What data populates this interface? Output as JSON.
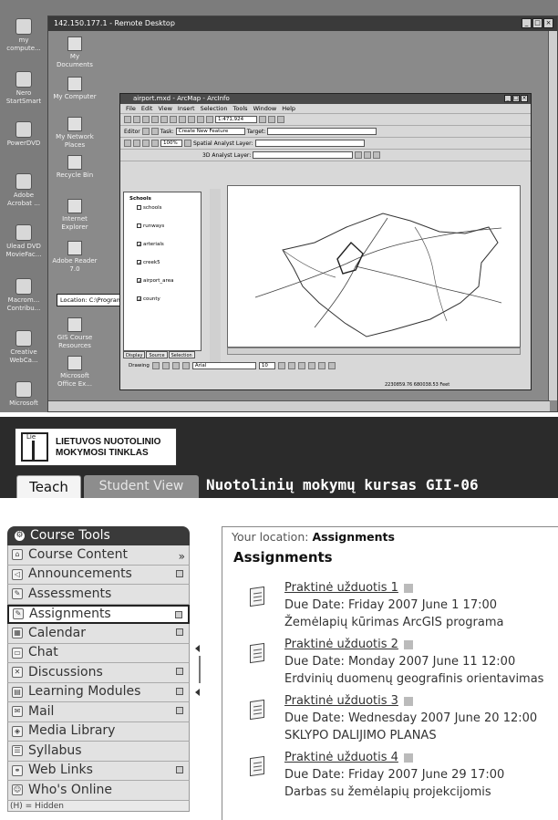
{
  "remote_desktop": {
    "title": "142.150.177.1 - Remote Desktop",
    "outer_icons": [
      "my\ncompute...",
      "Nero\nStartSmart",
      "PowerDVD",
      "Adobe\nAcrobat ...",
      "Ulead DVD\nMovieFac...",
      "Macrom...\nContribu...",
      "Creative\nWebCa...",
      "Microsoft"
    ],
    "inner_icons": [
      "My Documents",
      "My Computer",
      "My Network\nPlaces",
      "Recycle Bin",
      "Internet\nExplorer",
      "Adobe Reader\n7.0",
      "GIS Course\nResources",
      "Microsoft\nOffice Ex..."
    ],
    "tooltip": "Location: C:\\Program Files\\ArcGIS\\bin"
  },
  "arcmap": {
    "title": "airport.mxd - ArcMap - ArcInfo",
    "menu": [
      "File",
      "Edit",
      "View",
      "Insert",
      "Selection",
      "Tools",
      "Window",
      "Help"
    ],
    "scale": "1:471,924",
    "editor_label": "Editor",
    "task_label": "Task:",
    "task_value": "Create New Feature",
    "target_label": "Target:",
    "zoom_value": "100%",
    "spatial_analyst": "Spatial Analyst",
    "layer_label": "Layer:",
    "analyst_3d": "3D Analyst",
    "toc_root": "Schools",
    "layers": [
      "schools",
      "runways",
      "arterials",
      "creek5",
      "airport_area",
      "county"
    ],
    "toc_tabs": [
      "Display",
      "Source",
      "Selection"
    ],
    "drawing": "Drawing",
    "font": "Arial",
    "font_size": "10",
    "coords": "2230859.76 680038.53 Feet"
  },
  "lms": {
    "logo_lines": [
      "LIETUVOS NUOTOLINIO",
      "MOKYMOSI TINKLAS"
    ],
    "logo_mark": "Lie",
    "tab_teach": "Teach",
    "tab_student": "Student View",
    "course_title": "Nuotolinių mokymų kursas GII-06",
    "course_tools": "Course Tools",
    "nav": [
      {
        "label": "Course Content"
      },
      {
        "label": "Announcements"
      },
      {
        "label": "Assessments"
      },
      {
        "label": "Assignments"
      },
      {
        "label": "Calendar"
      },
      {
        "label": "Chat"
      },
      {
        "label": "Discussions"
      },
      {
        "label": "Learning Modules"
      },
      {
        "label": "Mail"
      },
      {
        "label": "Media Library"
      },
      {
        "label": "Syllabus"
      },
      {
        "label": "Web Links"
      },
      {
        "label": "Who's Online"
      }
    ],
    "hidden_note": "(H) = Hidden",
    "location_label": "Your location:",
    "location_value": "Assignments",
    "heading": "Assignments",
    "assignments": [
      {
        "title": "Praktinė užduotis 1",
        "due": "Due Date: Friday 2007 June 1 17:00",
        "desc": "Žemėlapių kūrimas ArcGIS programa"
      },
      {
        "title": "Praktinė užduotis 2",
        "due": "Due Date: Monday 2007 June 11 12:00",
        "desc": "Erdvinių duomenų geografinis orientavimas"
      },
      {
        "title": "Praktinė užduotis 3",
        "due": "Due Date: Wednesday 2007 June 20 12:00",
        "desc": "SKLYPO DALIJIMO PLANAS"
      },
      {
        "title": "Praktinė užduotis 4",
        "due": "Due Date: Friday 2007 June 29 17:00",
        "desc": "Darbas su žemėlapių projekcijomis"
      }
    ]
  }
}
